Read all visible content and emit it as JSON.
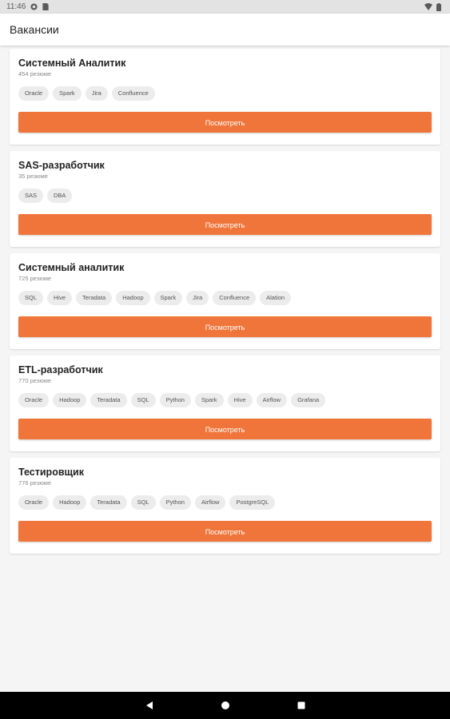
{
  "status_bar": {
    "time": "11:46",
    "icons": [
      "cloud-icon",
      "sim-icon",
      "wifi-icon",
      "battery-icon"
    ]
  },
  "app_bar": {
    "title": "Вакансии"
  },
  "jobs": [
    {
      "title": "Системный Аналитик",
      "count": "454 резюме",
      "tags": [
        "Oracle",
        "Spark",
        "Jira",
        "Confluence"
      ],
      "button": "Посмотреть"
    },
    {
      "title": "SAS-разработчик",
      "count": "35 резюме",
      "tags": [
        "SAS",
        "DBA"
      ],
      "button": "Посмотреть"
    },
    {
      "title": "Системный аналитик",
      "count": "725 резюме",
      "tags": [
        "SQL",
        "Hive",
        "Teradata",
        "Hadoop",
        "Spark",
        "Jira",
        "Confluence",
        "Alation"
      ],
      "button": "Посмотреть"
    },
    {
      "title": "ETL-разработчик",
      "count": "770 резюме",
      "tags": [
        "Oracle",
        "Hadoop",
        "Teradata",
        "SQL",
        "Python",
        "Spark",
        "Hive",
        "Airflow",
        "Grafana"
      ],
      "button": "Посмотреть"
    },
    {
      "title": "Тестировщик",
      "count": "776 резюме",
      "tags": [
        "Oracle",
        "Hadoop",
        "Teradata",
        "SQL",
        "Python",
        "Airflow",
        "PostgreSQL"
      ],
      "button": "Посмотреть"
    }
  ],
  "nav": {
    "icons": [
      "back-icon",
      "home-icon",
      "recents-icon"
    ]
  },
  "colors": {
    "accent": "#f0753a",
    "tag_bg": "#ececec",
    "background": "#f5f5f5"
  }
}
